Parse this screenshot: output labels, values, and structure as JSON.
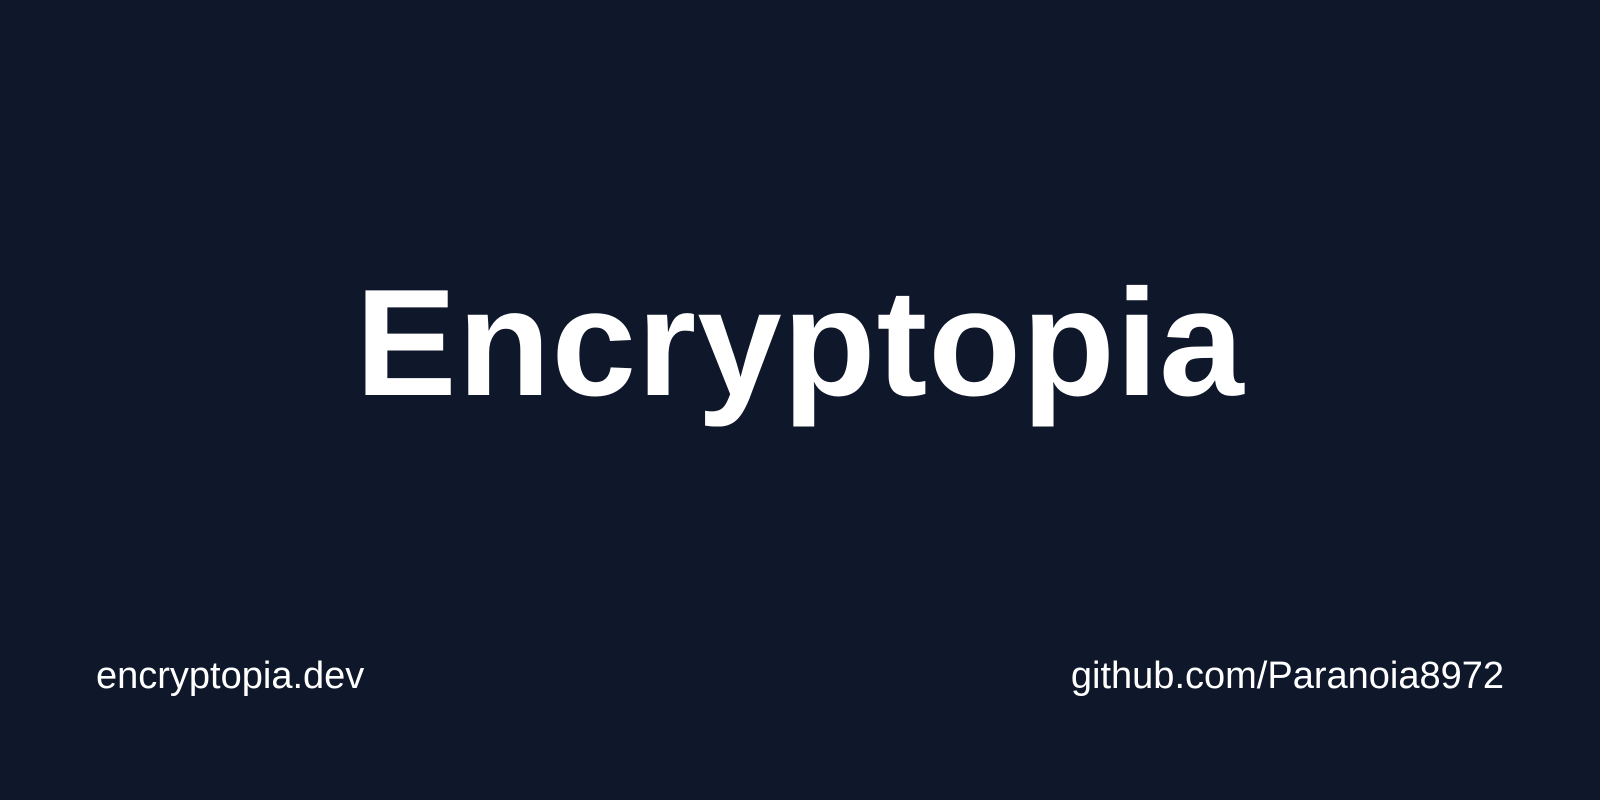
{
  "brand": {
    "title": "Encryptopia",
    "website": "encryptopia.dev",
    "repository": "github.com/Paranoia8972"
  },
  "colors": {
    "background": "#0f172a",
    "text": "#ffffff"
  }
}
